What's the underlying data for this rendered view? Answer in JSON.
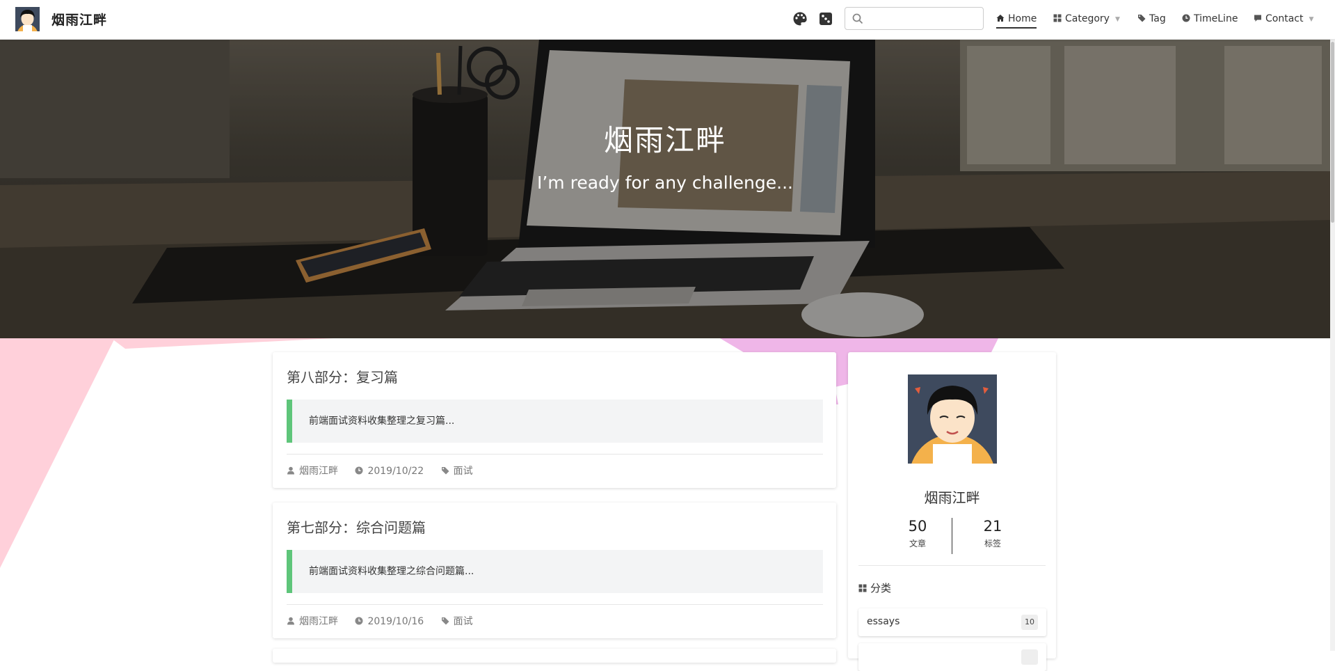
{
  "header": {
    "site_title": "烟雨江畔",
    "icons": [
      "palette-icon",
      "dice-icon"
    ],
    "search": {
      "value": "",
      "placeholder": ""
    },
    "nav": [
      {
        "label": "Home",
        "icon": "home-icon",
        "active": true
      },
      {
        "label": "Category",
        "icon": "grid-icon",
        "dropdown": true
      },
      {
        "label": "Tag",
        "icon": "tag-icon"
      },
      {
        "label": "TimeLine",
        "icon": "clock-icon"
      },
      {
        "label": "Contact",
        "icon": "comment-icon",
        "dropdown": true
      }
    ]
  },
  "hero": {
    "title": "烟雨江畔",
    "subtitle": "I’m ready for any challenge..."
  },
  "posts": [
    {
      "title": "第八部分：复习篇",
      "excerpt": "前端面试资料收集整理之复习篇...",
      "author": "烟雨江畔",
      "date": "2019/10/22",
      "tag": "面试"
    },
    {
      "title": "第七部分：综合问题篇",
      "excerpt": "前端面试资料收集整理之综合问题篇...",
      "author": "烟雨江畔",
      "date": "2019/10/16",
      "tag": "面试"
    }
  ],
  "profile": {
    "name": "烟雨江畔",
    "stats": [
      {
        "value": "50",
        "label": "文章"
      },
      {
        "value": "21",
        "label": "标签"
      }
    ],
    "categories_heading": "分类",
    "categories": [
      {
        "name": "essays",
        "count": "10"
      },
      {
        "name": "",
        "count": ""
      }
    ]
  },
  "colors": {
    "accent_green": "#5ec57a",
    "pink_shape": "#ffd0da",
    "lilac_shape": "#efb6e8"
  }
}
